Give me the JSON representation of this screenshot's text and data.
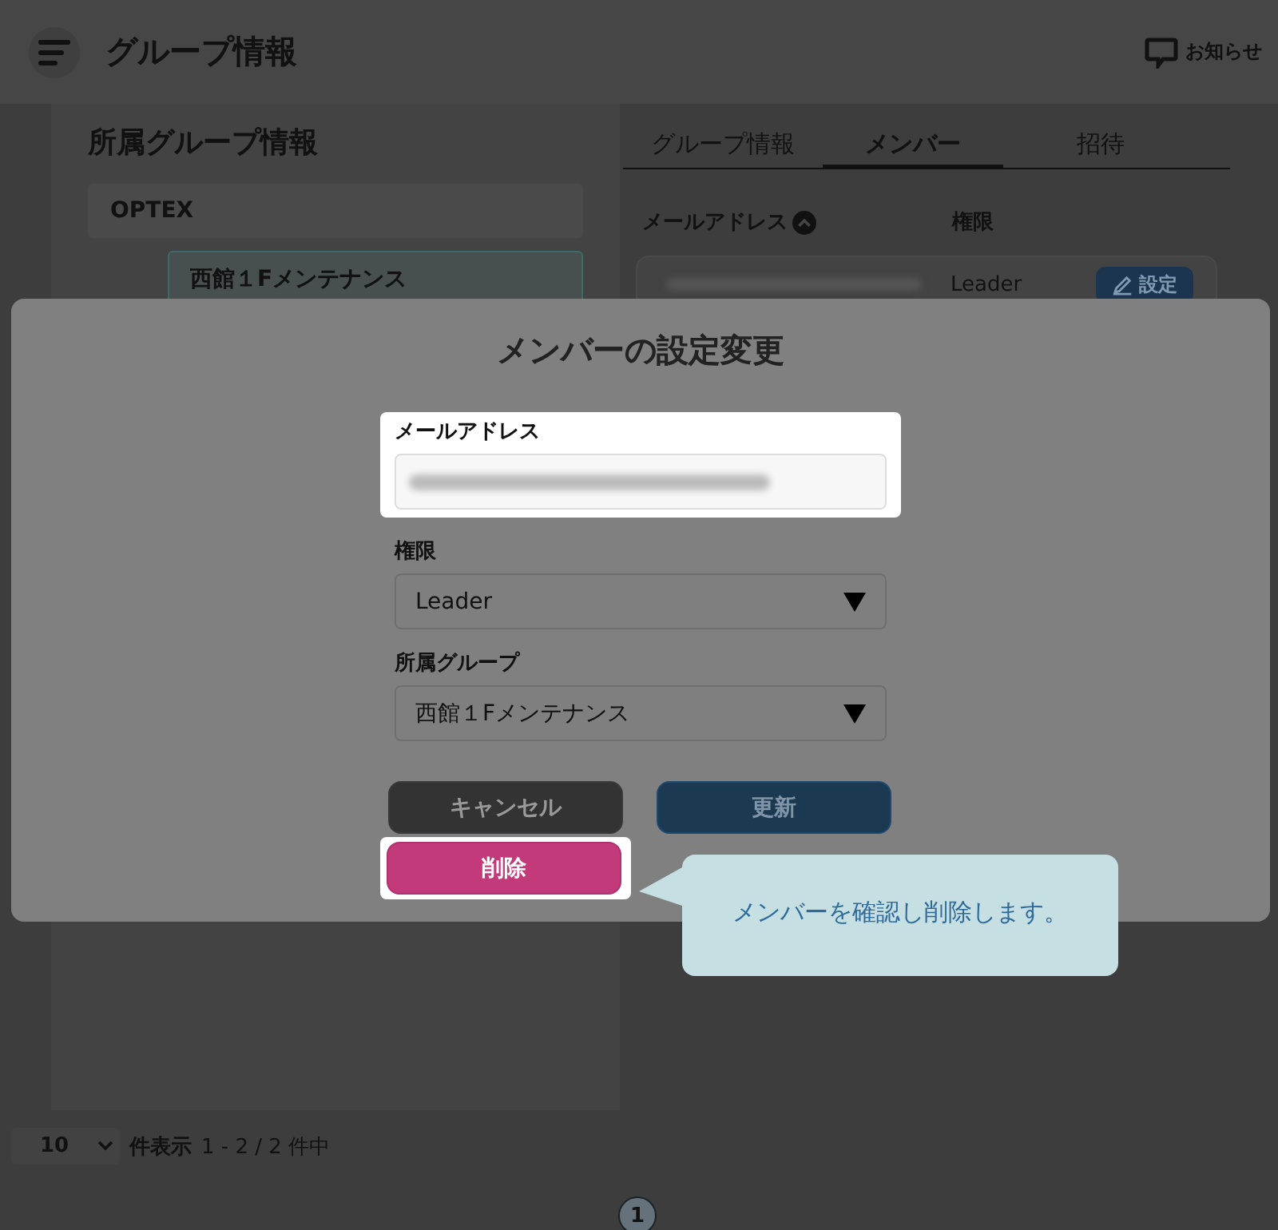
{
  "header": {
    "title": "グループ情報",
    "notice_label": "お知らせ"
  },
  "sidebar": {
    "title": "所属グループ情報",
    "groups": [
      {
        "name": "OPTEX",
        "selected": false,
        "children": [
          {
            "name": "西館１Fメンテナンス",
            "selected": true
          }
        ]
      }
    ]
  },
  "tabs": [
    {
      "label": "グループ情報",
      "selected": false
    },
    {
      "label": "メンバー",
      "selected": true
    },
    {
      "label": "招待",
      "selected": false
    }
  ],
  "member_table": {
    "columns": [
      "メールアドレス",
      "権限"
    ],
    "rows": [
      {
        "role": "Leader",
        "action": "設定"
      }
    ]
  },
  "dialog": {
    "title": "メンバーの設定変更",
    "fields": [
      {
        "kind": "text",
        "label": "メールアドレス",
        "highlighted": true
      },
      {
        "kind": "select",
        "label": "権限",
        "value": "Leader",
        "highlighted": false
      },
      {
        "kind": "select",
        "label": "所属グループ",
        "value": "西館１Fメンテナンス",
        "highlighted": false
      }
    ],
    "buttons": [
      {
        "kind": "cancel",
        "label": "キャンセル",
        "highlighted": false
      },
      {
        "kind": "update",
        "label": "更新",
        "highlighted": false
      },
      {
        "kind": "delete",
        "label": "削除",
        "highlighted": true
      }
    ]
  },
  "callout": {
    "text": "メンバーを確認し削除します。"
  },
  "pagination": {
    "page_size": "10",
    "page_size_label": "件表示",
    "range": "1 - 2 / 2 件中",
    "pages": [
      {
        "label": "1",
        "selected": true
      }
    ]
  }
}
